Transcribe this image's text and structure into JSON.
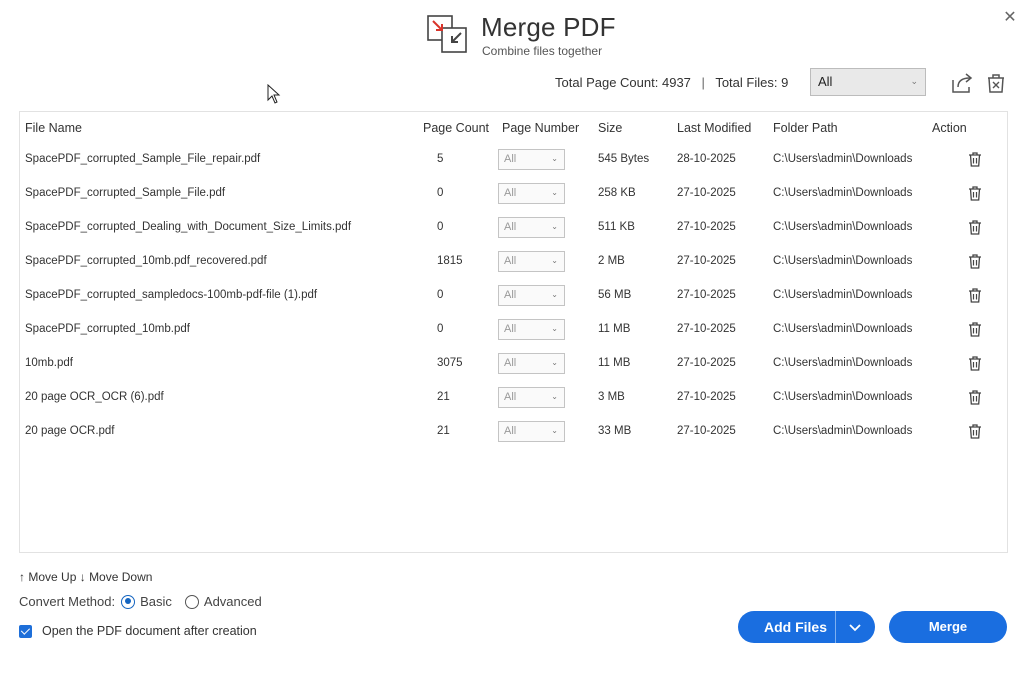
{
  "window": {
    "close_symbol": "✕"
  },
  "header": {
    "title": "Merge PDF",
    "subtitle": "Combine files together",
    "logo_icon": "merge-arrows-icon"
  },
  "stats": {
    "page_count_label": "Total Page Count:",
    "page_count_value": "4937",
    "separator": "|",
    "files_label": "Total Files:",
    "files_value": "9"
  },
  "filter": {
    "selected": "All"
  },
  "toolbar_icons": [
    "share-icon",
    "clear-all-icon"
  ],
  "table": {
    "columns": [
      "File Name",
      "Page Count",
      "Page Number",
      "Size",
      "Last Modified",
      "Folder Path",
      "Action"
    ],
    "rows": [
      {
        "name": "SpacePDF_corrupted_Sample_File_repair.pdf",
        "pages": "5",
        "page_number": "All",
        "size": "545 Bytes",
        "modified": "28-10-2025",
        "folder": "C:\\Users\\admin\\Downloads"
      },
      {
        "name": "SpacePDF_corrupted_Sample_File.pdf",
        "pages": "0",
        "page_number": "All",
        "size": "258 KB",
        "modified": "27-10-2025",
        "folder": "C:\\Users\\admin\\Downloads"
      },
      {
        "name": "SpacePDF_corrupted_Dealing_with_Document_Size_Limits.pdf",
        "pages": "0",
        "page_number": "All",
        "size": "511 KB",
        "modified": "27-10-2025",
        "folder": "C:\\Users\\admin\\Downloads"
      },
      {
        "name": "SpacePDF_corrupted_10mb.pdf_recovered.pdf",
        "pages": "1815",
        "page_number": "All",
        "size": "2 MB",
        "modified": "27-10-2025",
        "folder": "C:\\Users\\admin\\Downloads"
      },
      {
        "name": "SpacePDF_corrupted_sampledocs-100mb-pdf-file (1).pdf",
        "pages": "0",
        "page_number": "All",
        "size": "56 MB",
        "modified": "27-10-2025",
        "folder": "C:\\Users\\admin\\Downloads"
      },
      {
        "name": "SpacePDF_corrupted_10mb.pdf",
        "pages": "0",
        "page_number": "All",
        "size": "11 MB",
        "modified": "27-10-2025",
        "folder": "C:\\Users\\admin\\Downloads"
      },
      {
        "name": "10mb.pdf",
        "pages": "3075",
        "page_number": "All",
        "size": "11 MB",
        "modified": "27-10-2025",
        "folder": "C:\\Users\\admin\\Downloads"
      },
      {
        "name": "20 page OCR_OCR (6).pdf",
        "pages": "21",
        "page_number": "All",
        "size": "3 MB",
        "modified": "27-10-2025",
        "folder": "C:\\Users\\admin\\Downloads"
      },
      {
        "name": "20 page OCR.pdf",
        "pages": "21",
        "page_number": "All",
        "size": "33 MB",
        "modified": "27-10-2025",
        "folder": "C:\\Users\\admin\\Downloads"
      }
    ]
  },
  "controls": {
    "move_up": "Move Up",
    "move_down": "Move Down",
    "convert_label": "Convert Method:",
    "options": [
      "Basic",
      "Advanced"
    ],
    "selected_option": "Basic",
    "open_after_label": "Open the PDF document after creation",
    "open_after_checked": true
  },
  "buttons": {
    "add_files": "Add Files",
    "merge": "Merge"
  },
  "colors": {
    "accent": "#1a6ee0",
    "logo_red": "#d9342b",
    "text": "#333333"
  }
}
